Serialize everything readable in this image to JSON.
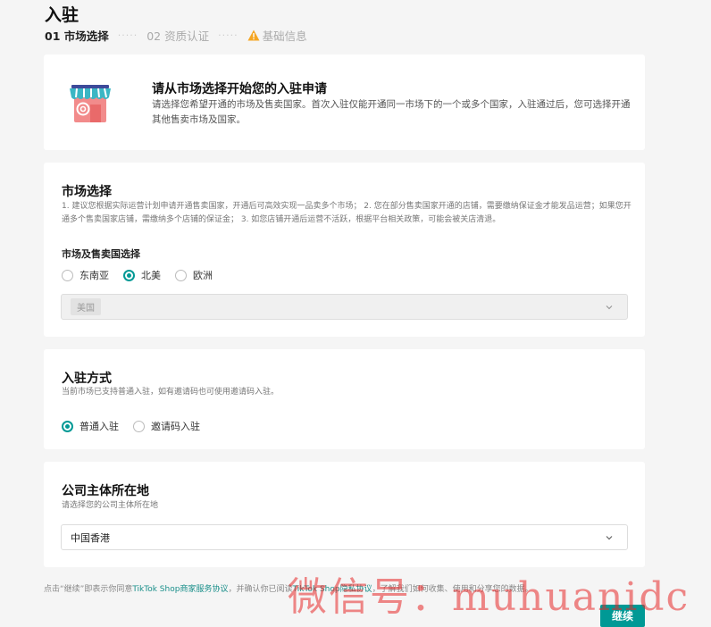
{
  "page": {
    "title": "入驻"
  },
  "steps": {
    "step1": "01 市场选择",
    "step2": "02 资质认证",
    "step3": "基础信息",
    "dots": "·····"
  },
  "intro": {
    "title": "请从市场选择开始您的入驻申请",
    "desc": "请选择您希望开通的市场及售卖国家。首次入驻仅能开通同一市场下的一个或多个国家，入驻通过后，您可选择开通其他售卖市场及国家。"
  },
  "market": {
    "title": "市场选择",
    "desc": "1. 建议您根据实际运营计划申请开通售卖国家，开通后可高效实现一品卖多个市场； 2. 您在部分售卖国家开通的店铺，需要缴纳保证金才能发品运营；如果您开通多个售卖国家店铺，需缴纳多个店铺的保证金； 3. 如您店铺开通后运营不活跃，根据平台相关政策，可能会被关店清退。",
    "subtitle": "市场及售卖国选择",
    "options": [
      "东南亚",
      "北美",
      "欧洲"
    ],
    "selected_option": "北美",
    "country_tag": "美国"
  },
  "entry": {
    "title": "入驻方式",
    "desc": "当前市场已支持普通入驻，如有邀请码也可使用邀请码入驻。",
    "options": [
      "普通入驻",
      "邀请码入驻"
    ],
    "selected_option": "普通入驻"
  },
  "company": {
    "title": "公司主体所在地",
    "desc": "请选择您的公司主体所在地",
    "value": "中国香港"
  },
  "footer": {
    "prefix": "点击“继续”即表示你同意",
    "link1": "TikTok Shop商家服务协议",
    "middle": "，并确认你已阅读",
    "link2": "TikTok Shop隐私协议",
    "suffix": "，了解我们如何收集、使用和分享您的数据。",
    "continue_label": "继续"
  },
  "watermark": "微信号：muhuanidc",
  "colors": {
    "accent": "#009995",
    "warning": "#f5a623"
  }
}
